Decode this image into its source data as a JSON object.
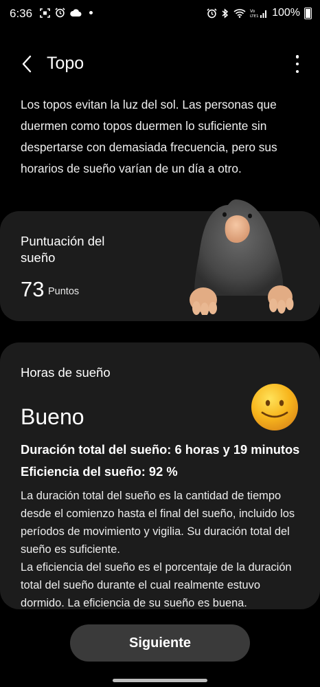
{
  "status_bar": {
    "time": "6:36",
    "battery": "100%",
    "left_icons": [
      "screenshot-icon",
      "alarm-icon",
      "cloud-icon",
      "notification-dot"
    ],
    "right_icons": [
      "alarm-icon",
      "bluetooth-icon",
      "wifi-icon",
      "volte-signal-icon",
      "battery-icon"
    ]
  },
  "header": {
    "title": "Topo",
    "back_icon": "chevron-left-icon",
    "more_icon": "more-vertical-icon"
  },
  "intro": "Los topos evitan la luz del sol. Las personas que duermen como topos duermen lo suficiente sin despertarse con demasiada frecuencia, pero sus horarios de sueño varían de un día a otro.",
  "score_card": {
    "label": "Puntuación del sueño",
    "value": "73",
    "unit": "Puntos",
    "illustration": "mole-illustration"
  },
  "hours_card": {
    "label": "Horas de sueño",
    "quality": "Bueno",
    "total_duration": "Duración total del sueño: 6 horas y 19 minutos",
    "efficiency": "Eficiencia del sueño: 92 %",
    "description_1": "La duración total del sueño es la cantidad de tiempo desde el comienzo hasta el final del sueño, incluido los períodos de movimiento y vigilia. Su duración total del sueño es suficiente.",
    "description_2": "La eficiencia del sueño es el porcentaje de la duración total del sueño durante el cual realmente estuvo dormido. La eficiencia de su sueño es buena.",
    "icon": "smiley-face-icon"
  },
  "next_button": "Siguiente",
  "colors": {
    "background": "#000000",
    "card": "#1c1c1c",
    "button": "#3a3a3a",
    "smiley": "#f7b51c"
  }
}
